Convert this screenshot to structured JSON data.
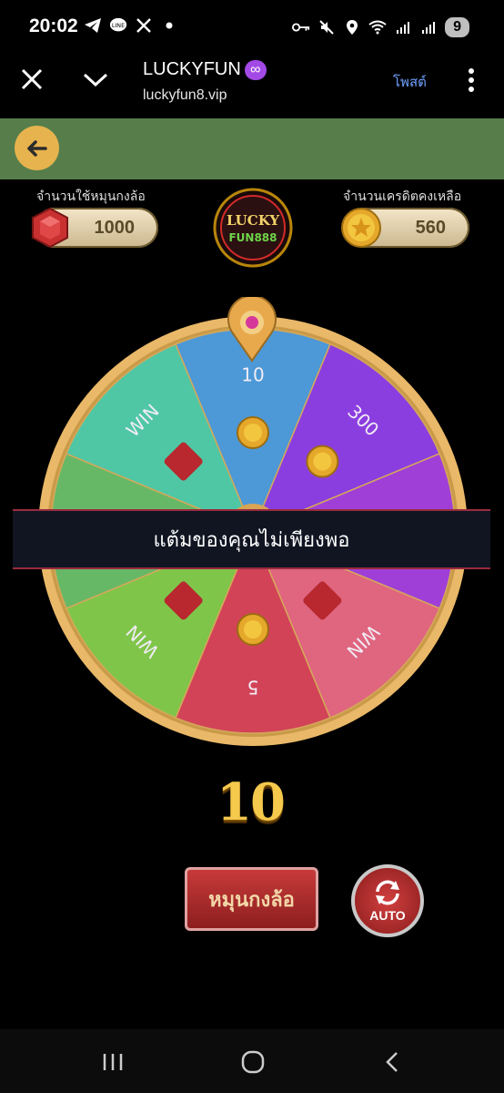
{
  "status_bar": {
    "time": "20:02",
    "battery": "9",
    "icons_left": [
      "telegram-icon",
      "line-icon",
      "x-icon",
      "dot-icon"
    ],
    "icons_right": [
      "key-icon",
      "mute-icon",
      "location-icon",
      "wifi-icon",
      "signal-icon",
      "signal-icon"
    ]
  },
  "browser": {
    "title": "LUCKYFUN",
    "title_emoji": "∞",
    "url": "luckyfun8.vip",
    "post_label": "โพสต์"
  },
  "game": {
    "spin_label": "จำนวนใช้หมุนกงล้อ",
    "spin_value": "1000",
    "credit_label": "จำนวนเครดิตคงเหลือ",
    "credit_value": "560",
    "logo_text_top": "LUCKY",
    "logo_text_bottom": "FUN888",
    "wheel_segments": [
      "10",
      "300",
      "",
      "WIN",
      "5",
      "WIN",
      "",
      "WIN"
    ],
    "toast_message": "แต้มของคุณไม่เพียงพอ",
    "counter": "10",
    "spin_button": "หมุนกงล้อ",
    "auto_button": "AUTO"
  },
  "colors": {
    "green_bar": "#577d4b",
    "back_button": "#e6b34e",
    "wheel_rim": "#e9b868",
    "toast_border": "#9a2b3e"
  }
}
